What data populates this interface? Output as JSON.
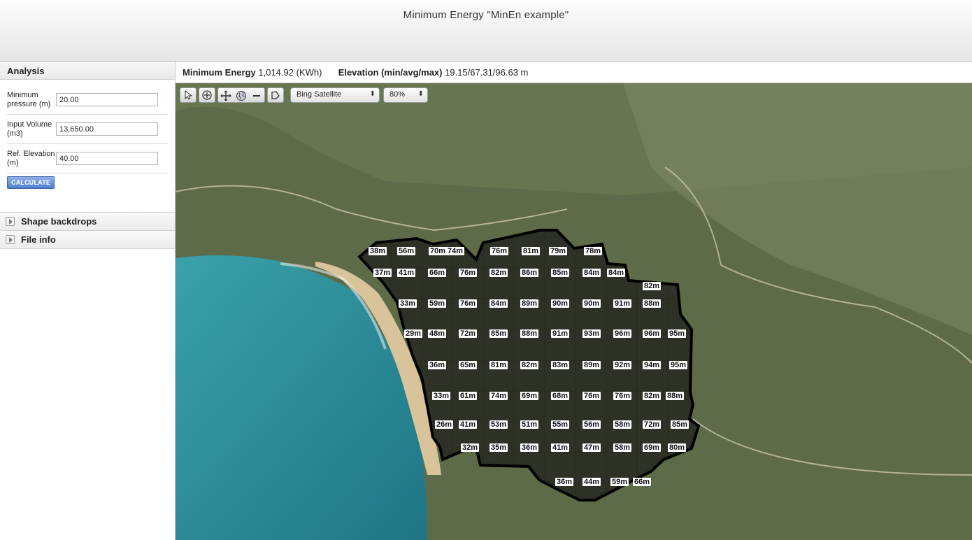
{
  "window": {
    "title": "Minimum Energy \"MinEn example\""
  },
  "sidebar": {
    "analysis_title": "Analysis",
    "fields": [
      {
        "label": "Minimum pressure (m)",
        "value": "20.00"
      },
      {
        "label": "Input Volume (m3)",
        "value": "13,650.00"
      },
      {
        "label": "Ref. Elevation (m)",
        "value": "40.00"
      }
    ],
    "calculate_label": "CALCULATE",
    "sections": [
      {
        "label": "Shape backdrops"
      },
      {
        "label": "File info"
      }
    ]
  },
  "infobar": {
    "energy_label": "Minimum Energy",
    "energy_value": "1,014.92 (KWh)",
    "elevation_label": "Elevation (min/avg/max)",
    "elevation_value": "19.15/67.31/96.63 m"
  },
  "toolbar": {
    "basemap_selected": "Bing Satellite",
    "opacity_selected": "80%"
  },
  "icons": {
    "select": "pointer-icon",
    "zoom_extent": "zoom-extent-icon",
    "pan": "pan-icon",
    "globe": "globe-icon",
    "zoom_out": "zoom-out-icon",
    "polygon": "polygon-icon"
  },
  "colors": {
    "ocean": "#2f8f9a",
    "beach": "#d8c39a",
    "land": "#5d6b48",
    "overlay": "#1c1a17",
    "outline": "#000000"
  },
  "grid_labels": [
    [
      "38m",
      "56m",
      "70m",
      "74m",
      "76m",
      "81m",
      "79m",
      "78m"
    ],
    [
      "37m",
      "41m",
      "66m",
      "76m",
      "82m",
      "86m",
      "85m",
      "84m",
      "84m"
    ],
    [
      "82m"
    ],
    [
      "33m",
      "59m",
      "76m",
      "84m",
      "89m",
      "90m",
      "90m",
      "91m",
      "88m"
    ],
    [
      "29m",
      "48m",
      "72m",
      "85m",
      "88m",
      "91m",
      "93m",
      "96m",
      "96m",
      "95m"
    ],
    [
      "36m",
      "65m",
      "81m",
      "82m",
      "83m",
      "89m",
      "92m",
      "94m",
      "95m"
    ],
    [
      "33m",
      "61m",
      "74m",
      "69m",
      "68m",
      "76m",
      "76m",
      "82m",
      "88m"
    ],
    [
      "26m",
      "41m",
      "53m",
      "51m",
      "55m",
      "56m",
      "58m",
      "72m",
      "85m"
    ],
    [
      "32m",
      "35m",
      "36m",
      "41m",
      "47m",
      "58m",
      "69m",
      "80m"
    ],
    [
      "36m",
      "44m",
      "59m",
      "66m"
    ]
  ]
}
